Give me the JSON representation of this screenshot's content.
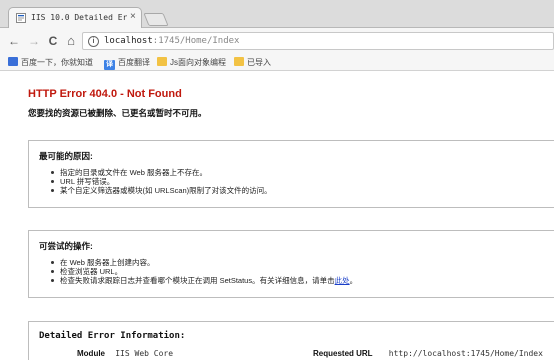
{
  "browser": {
    "tab_title": "IIS 10.0 Detailed Err",
    "tab_close": "×",
    "back": "←",
    "forward": "→",
    "reload": "C",
    "home": "⌂",
    "info": "i",
    "url_host": "localhost",
    "url_path": ":1745/Home/Index"
  },
  "bookmarks": [
    {
      "label": "百度一下，你就知道",
      "icon": "baidu-icon"
    },
    {
      "label": "百度翻译",
      "icon": "translate-icon"
    },
    {
      "label": "Js面向对象编程",
      "icon": "folder-icon"
    },
    {
      "label": "已导入",
      "icon": "folder-icon"
    }
  ],
  "error": {
    "title": "HTTP Error 404.0 - Not Found",
    "subtitle": "您要找的资源已被删除、已更名或暂时不可用。"
  },
  "causes": {
    "heading": "最可能的原因:",
    "items": [
      "指定的目录或文件在 Web 服务器上不存在。",
      "URL 拼写错误。",
      "某个自定义筛选器或模块(如 URLScan)限制了对该文件的访问。"
    ]
  },
  "actions": {
    "heading": "可尝试的操作:",
    "items": [
      "在 Web 服务器上创建内容。",
      "检查浏览器 URL。",
      "检查失败请求跟踪日志并查看哪个模块正在调用 SetStatus。有关详细信息，请单击"
    ],
    "link_text": "此处",
    "link_suffix": "。"
  },
  "details": {
    "heading": "Detailed Error Information:",
    "module_label": "Module",
    "module_value": "IIS Web Core",
    "requested_url_label": "Requested URL",
    "requested_url_value": "http://localhost:1745/Home/Index"
  },
  "colors": {
    "error_title": "#c0180d",
    "link": "#1a3fc8"
  }
}
